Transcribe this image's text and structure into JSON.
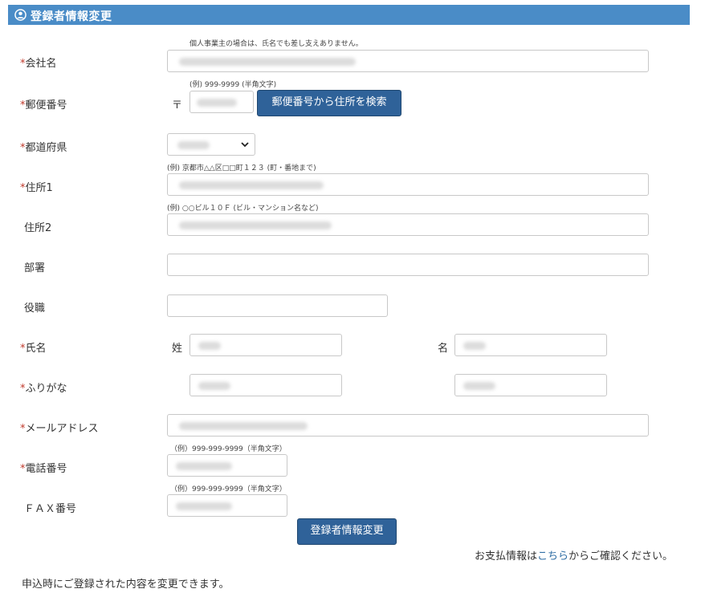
{
  "header": {
    "title": "登録者情報変更",
    "icon": "user-circle-icon",
    "color": "#4a8cc7"
  },
  "form": {
    "required_mark": "*",
    "company": {
      "label": "会社名",
      "hint": "個人事業主の場合は、氏名でも差し支えありません。"
    },
    "postal": {
      "label": "郵便番号",
      "hint": "(例) 999-9999 (半角文字)",
      "prefix": "〒",
      "search_button": "郵便番号から住所を検索"
    },
    "prefecture": {
      "label": "都道府県"
    },
    "address1": {
      "label": "住所1",
      "hint": "(例) 京都市△△区□□町１２３ (町・番地まで)"
    },
    "address2": {
      "label": "住所2",
      "hint": "(例) ○○ビル１０Ｆ (ビル・マンション名など)"
    },
    "department": {
      "label": "部署"
    },
    "position": {
      "label": "役職"
    },
    "name": {
      "label": "氏名",
      "last_label": "姓",
      "first_label": "名"
    },
    "furigana": {
      "label": "ふりがな"
    },
    "email": {
      "label": "メールアドレス"
    },
    "phone": {
      "label": "電話番号",
      "hint": "（例）999-999-9999（半角文字）"
    },
    "fax": {
      "label": "ＦＡＸ番号",
      "hint": "（例）999-999-9999（半角文字）"
    },
    "submit_button": "登録者情報変更"
  },
  "footer": {
    "payment_prefix": "お支払情報は",
    "payment_link": "こちら",
    "payment_suffix": "からご確認ください。",
    "note": "申込時にご登録された内容を変更できます。"
  }
}
